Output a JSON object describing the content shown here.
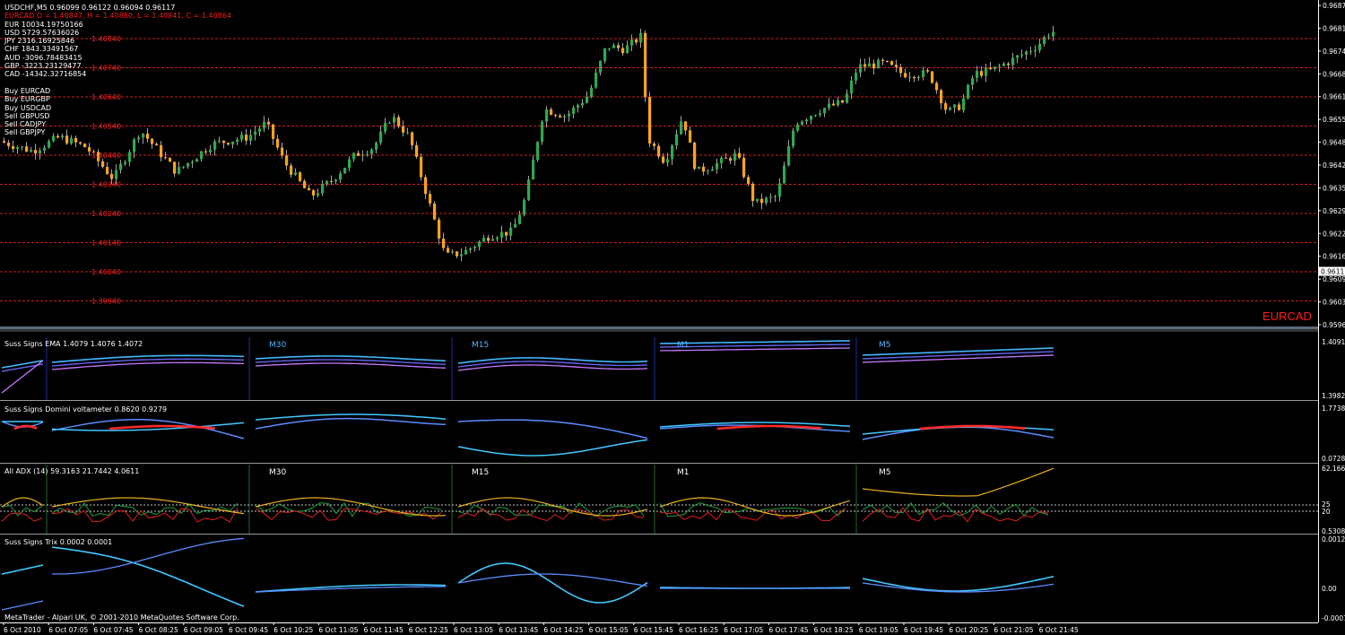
{
  "window": {
    "header": "USDCHF,M5  0.96099 0.96122 0.96094 0.96117",
    "overlay": "EURCAD O = 1.40847, H = 1.40880, L = 1.40841, C = 1.40864",
    "watermark": "EURCAD",
    "copyright": "MetaTrader - Alpari UK, © 2001-2010 MetaQuotes Software Corp."
  },
  "strength": [
    "EUR 10034.19750166",
    "USD 5729.57636026",
    "JPY 2316.16925846",
    "CHF 1843.33491567",
    "AUD -3096.78483415",
    "GBP -3223.23129477",
    "CAD -14342.32716854"
  ],
  "signals": [
    "Buy EURCAD",
    "Buy EURGBP",
    "Buy USDCAD",
    "Sell GBPUSD",
    "Sell CADJPY",
    "Sell GBPJPY"
  ],
  "colors": {
    "up": "#2fa84f",
    "down": "#ffa320",
    "grid": "#c81e1e",
    "axis": "#ffffff"
  },
  "main_axis": {
    "right_ticks": [
      "0.96875",
      "0.96810",
      "0.96745",
      "0.96680",
      "0.96615",
      "0.96550",
      "0.96485",
      "0.96420",
      "0.96355",
      "0.96290",
      "0.96225",
      "0.96160",
      "0.96095",
      "0.96030",
      "0.95965"
    ],
    "current_price": "0.96117",
    "overlay_levels": [
      "1.40840",
      "1.40740",
      "1.40640",
      "1.40540",
      "1.40440",
      "1.40340",
      "1.40240",
      "1.40140",
      "1.40040",
      "1.39940"
    ]
  },
  "panes": [
    {
      "title": "Suss Signs EMA 1.4079 1.4076 1.4072",
      "axis": [
        "1.4091",
        "1.3982"
      ]
    },
    {
      "title": "Suss Signs Domini voltameter 0.8620 0.9279",
      "axis": [
        "1.7738",
        "0.0728"
      ]
    },
    {
      "title": "All ADX (14) 59.3163 21.7442 4.0611",
      "axis": [
        "62.1662",
        "25",
        "20",
        "0.5308"
      ]
    },
    {
      "title": "Suss Signs Trix 0.0002 0.0001",
      "axis": [
        "0.0012",
        "0.00",
        "-0.0007"
      ]
    }
  ],
  "timeframes": [
    "M30",
    "M15",
    "M1",
    "M5"
  ],
  "time_axis": [
    "6 Oct 2010",
    "6 Oct 07:05",
    "6 Oct 07:45",
    "6 Oct 08:25",
    "6 Oct 09:05",
    "6 Oct 09:45",
    "6 Oct 10:25",
    "6 Oct 11:05",
    "6 Oct 11:45",
    "6 Oct 12:25",
    "6 Oct 13:05",
    "6 Oct 13:45",
    "6 Oct 14:25",
    "6 Oct 15:05",
    "6 Oct 15:45",
    "6 Oct 16:25",
    "6 Oct 17:05",
    "6 Oct 17:45",
    "6 Oct 18:25",
    "6 Oct 19:05",
    "6 Oct 19:45",
    "6 Oct 20:25",
    "6 Oct 21:05",
    "6 Oct 21:45"
  ],
  "chart_data": {
    "type": "candlestick",
    "symbol": "USDCHF",
    "timeframe": "M5",
    "last_ohlc": {
      "open": 0.96099,
      "high": 0.96122,
      "low": 0.96094,
      "close": 0.96117
    },
    "y_range": [
      0.95965,
      0.96875
    ],
    "candles_shown": 235
  }
}
